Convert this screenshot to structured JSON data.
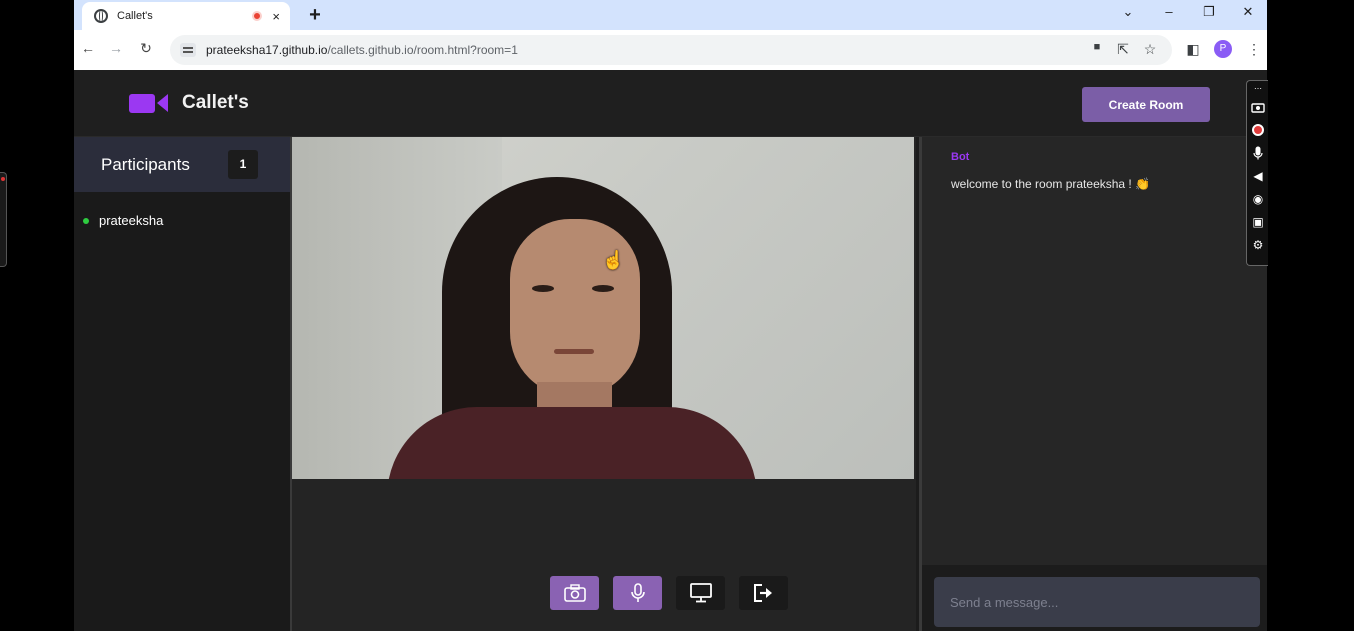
{
  "browser": {
    "tab_title": "Callet's",
    "tab_close": "×",
    "new_tab": "+",
    "window_controls": [
      "⌄",
      "–",
      "❐",
      "✕"
    ],
    "url_host": "prateeksha17.github.io",
    "url_path": "/callets.github.io/room.html?room=1",
    "profile_initial": "P"
  },
  "app": {
    "logo_text": "Callet's",
    "create_room_label": "Create Room",
    "brand_color": "#9b38f2"
  },
  "participants": {
    "title": "Participants",
    "count": "1",
    "members": [
      {
        "name": "prateeksha",
        "status": "online"
      }
    ]
  },
  "controls": [
    {
      "icon": "camera-icon",
      "active": true
    },
    {
      "icon": "microphone-icon",
      "active": true
    },
    {
      "icon": "screen-share-icon",
      "active": false
    },
    {
      "icon": "leave-icon",
      "active": false
    }
  ],
  "chat": {
    "messages": [
      {
        "from": "Bot",
        "text": "welcome to the room prateeksha ! 👏"
      }
    ],
    "input_placeholder": "Send a message..."
  }
}
